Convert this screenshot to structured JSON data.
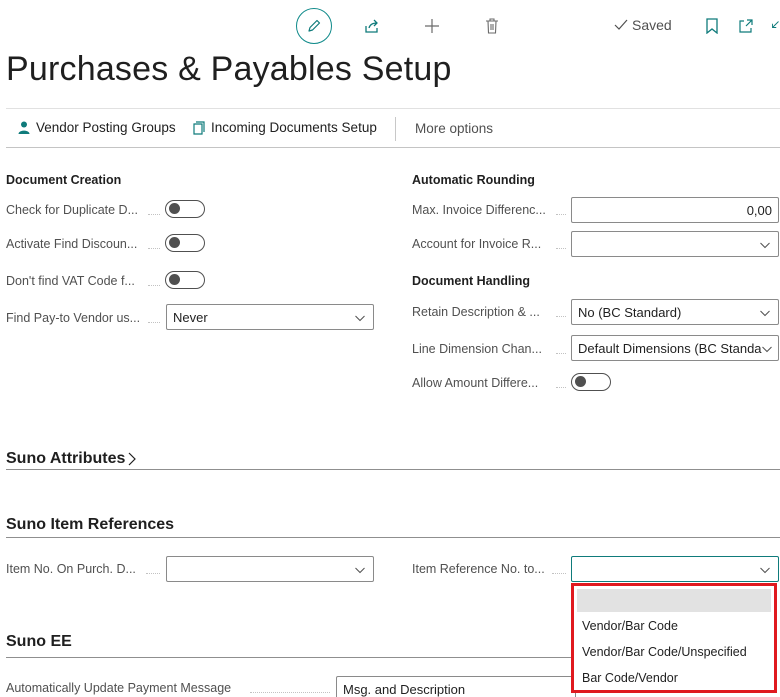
{
  "toolbar": {
    "saved_label": "Saved"
  },
  "page": {
    "title": "Purchases & Payables Setup"
  },
  "actions": {
    "vendor_posting_groups": "Vendor Posting Groups",
    "incoming_documents_setup": "Incoming Documents Setup",
    "more_options": "More options"
  },
  "document_creation": {
    "heading": "Document Creation",
    "fields": [
      {
        "label": "Check for Duplicate D...",
        "value": false
      },
      {
        "label": "Activate Find Discoun...",
        "value": false
      },
      {
        "label": "Don't find VAT Code f...",
        "value": false
      },
      {
        "label": "Find Pay-to Vendor us...",
        "value": "Never"
      }
    ]
  },
  "automatic_rounding": {
    "heading": "Automatic Rounding",
    "fields": [
      {
        "label": "Max. Invoice Differenc...",
        "value": "0,00"
      },
      {
        "label": "Account for Invoice R...",
        "value": ""
      }
    ]
  },
  "document_handling": {
    "heading": "Document Handling",
    "fields": [
      {
        "label": "Retain Description & ...",
        "value": "No (BC Standard)"
      },
      {
        "label": "Line Dimension Chan...",
        "value": "Default Dimensions (BC Standa"
      },
      {
        "label": "Allow Amount Differe...",
        "value": false
      }
    ]
  },
  "suno_attributes": {
    "title": "Suno Attributes"
  },
  "suno_item_references": {
    "title": "Suno Item References",
    "fields": [
      {
        "label": "Item No. On Purch. D...",
        "value": ""
      },
      {
        "label": "Item Reference No. to...",
        "value": ""
      }
    ]
  },
  "item_reference_dropdown": {
    "options": [
      "",
      "Vendor/Bar Code",
      "Vendor/Bar Code/Unspecified",
      "Bar Code/Vendor"
    ],
    "highlight_color": "#e0191f"
  },
  "suno_ee": {
    "title": "Suno EE",
    "fields": [
      {
        "label": "Automatically Update Payment Message",
        "value": "Msg. and Description"
      }
    ]
  },
  "colors": {
    "accent": "#0f7b7b"
  }
}
